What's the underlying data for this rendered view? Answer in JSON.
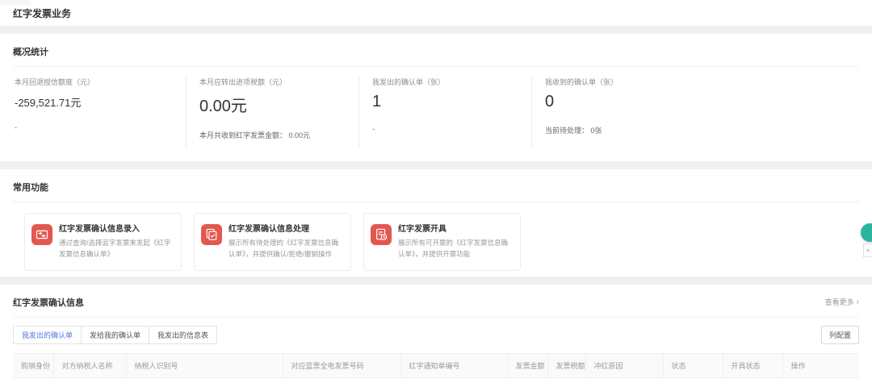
{
  "page": {
    "title": "红字发票业务"
  },
  "overview": {
    "title": "概况统计",
    "stats": [
      {
        "label": "本月回退授信额度（元）",
        "value": "-259,521.71元",
        "sub": "-"
      },
      {
        "label": "本月应转出进项税额（元）",
        "value": "0.00元",
        "sub": "本月共收到红字发票金额： 0.00元"
      },
      {
        "label": "我发出的确认单（张）",
        "value": "1",
        "sub": "-"
      },
      {
        "label": "我收到的确认单（张）",
        "value": "0",
        "sub": "当前待处理： 0张"
      }
    ]
  },
  "functions": {
    "title": "常用功能",
    "cards": [
      {
        "icon": "entry-icon",
        "title": "红字发票确认信息录入",
        "desc": "通过查询/选择蓝字发票来发起《红字发票信息确认单》"
      },
      {
        "icon": "process-icon",
        "title": "红字发票确认信息处理",
        "desc": "展示所有待处理的《红字发票信息确认单》，并提供确认/拒绝/撤销操作"
      },
      {
        "icon": "issue-icon",
        "title": "红字发票开具",
        "desc": "展示所有可开票的《红字发票信息确认单》，并提供开票功能"
      }
    ]
  },
  "confirmation": {
    "title": "红字发票确认信息",
    "view_more": "查看更多",
    "view_more_arrow": "›",
    "tabs": [
      {
        "label": "我发出的确认单",
        "active": true
      },
      {
        "label": "发给我的确认单",
        "active": false
      },
      {
        "label": "我发出的信息表",
        "active": false
      }
    ],
    "column_config": "列配置",
    "columns": [
      "购销身份",
      "对方纳税人名称",
      "纳税人识别号",
      "对应蓝票全电发票号码",
      "红字通知单编号",
      "发票金额",
      "发票税额",
      "冲红原因",
      "状态",
      "开具状态",
      "操作"
    ]
  },
  "colors": {
    "accent_red": "#e25850",
    "accent_blue": "#5677dd",
    "float_teal": "#2ab5a0",
    "page_background": "#f0f0f0"
  }
}
